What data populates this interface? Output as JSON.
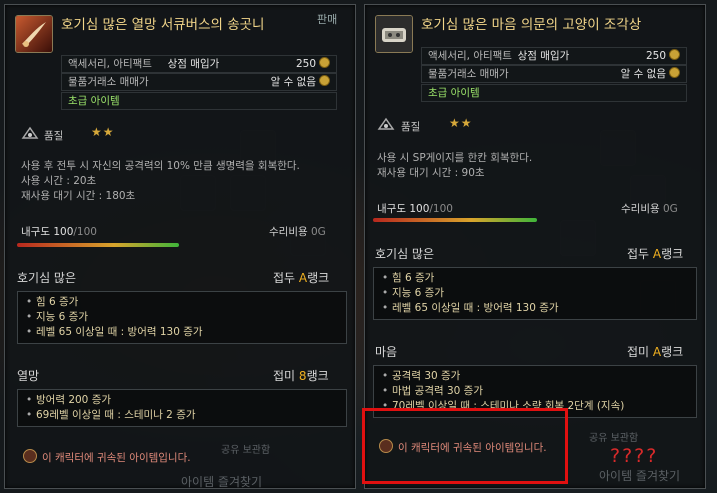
{
  "left_tooltip": {
    "title": "호기심 많은 열망 서큐버스의 송곳니",
    "category": "액세서리, 아티팩트",
    "shop_price_label": "상점 매입가",
    "shop_price": "250",
    "trade_label": "물품거래소 매매가",
    "trade_value": "알 수 없음",
    "tier": "초급 아이템",
    "grade_label": "품질",
    "stars": "★★",
    "desc_lines": [
      "사용 후 전투 시 자신의 공격력의 10% 만큼 생명력을 회복한다.",
      "사용 시간 : 20초",
      "재사용 대기 시간 : 180초"
    ],
    "durability_label": "내구도",
    "durability_cur": "100",
    "durability_max": "/100",
    "durability_fraction": 1.0,
    "repair_label": "수리비용",
    "repair_value": "0G",
    "section1": {
      "name": "호기심 많은",
      "rank_prefix": "접두",
      "rank_grade": "A",
      "rank_suffix": "랭크",
      "stats": [
        "힘 6 증가",
        "지능 6 증가",
        "레벨 65 이상일 때 : 방어력 130 증가"
      ]
    },
    "section2": {
      "name": "열망",
      "rank_prefix": "접미",
      "rank_grade": "8",
      "rank_suffix": "랭크",
      "stats": [
        "방어력 200 증가",
        "69레벨 이상일 때 : 스테미나 2 증가"
      ]
    },
    "bound_text": "이 캐릭터에 귀속된 아이템입니다."
  },
  "right_tooltip": {
    "title": "호기심 많은 마음 의문의 고양이 조각상",
    "category": "액세서리, 아티팩트",
    "shop_price_label": "상점 매입가",
    "shop_price": "250",
    "trade_label": "물품거래소 매매가",
    "trade_value": "알 수 없음",
    "tier": "초급 아이템",
    "grade_label": "품질",
    "stars": "★★",
    "desc_lines": [
      "사용 시 SP게이지를 한칸 회복한다.",
      "재사용 대기 시간 : 90초"
    ],
    "durability_label": "내구도",
    "durability_cur": "100",
    "durability_max": "/100",
    "durability_fraction": 1.0,
    "repair_label": "수리비용",
    "repair_value": "0G",
    "section1": {
      "name": "호기심 많은",
      "rank_prefix": "접두",
      "rank_grade": "A",
      "rank_suffix": "랭크",
      "stats": [
        "힘 6 증가",
        "지능 6 증가",
        "레벨 65 이상일 때 : 방어력 130 증가"
      ]
    },
    "section2": {
      "name": "마음",
      "rank_prefix": "접미",
      "rank_grade": "A",
      "rank_suffix": "랭크",
      "stats": [
        "공격력 30 증가",
        "마법 공격력 30 증가",
        "70레벨 이상일 때 : 스테미나 소량 회복 2단계 (지속)"
      ]
    },
    "bound_text": "이 캐릭터에 귀속된 아이템입니다."
  },
  "background": {
    "left_tab": "판매",
    "ghost_shared_left": "공유 보관함",
    "ghost_fav_left": "아이템 즐겨찾기",
    "ghost_shared_right": "공유 보관함",
    "ghost_fav_right": "아이템 즐겨찾기"
  },
  "annotation": {
    "question": "????",
    "highlight_color": "#e01010"
  },
  "colors": {
    "title": "#f2d68a",
    "rank_grade": "#f0b020",
    "tier_green": "#9be36a",
    "bound": "#e08a7a"
  }
}
